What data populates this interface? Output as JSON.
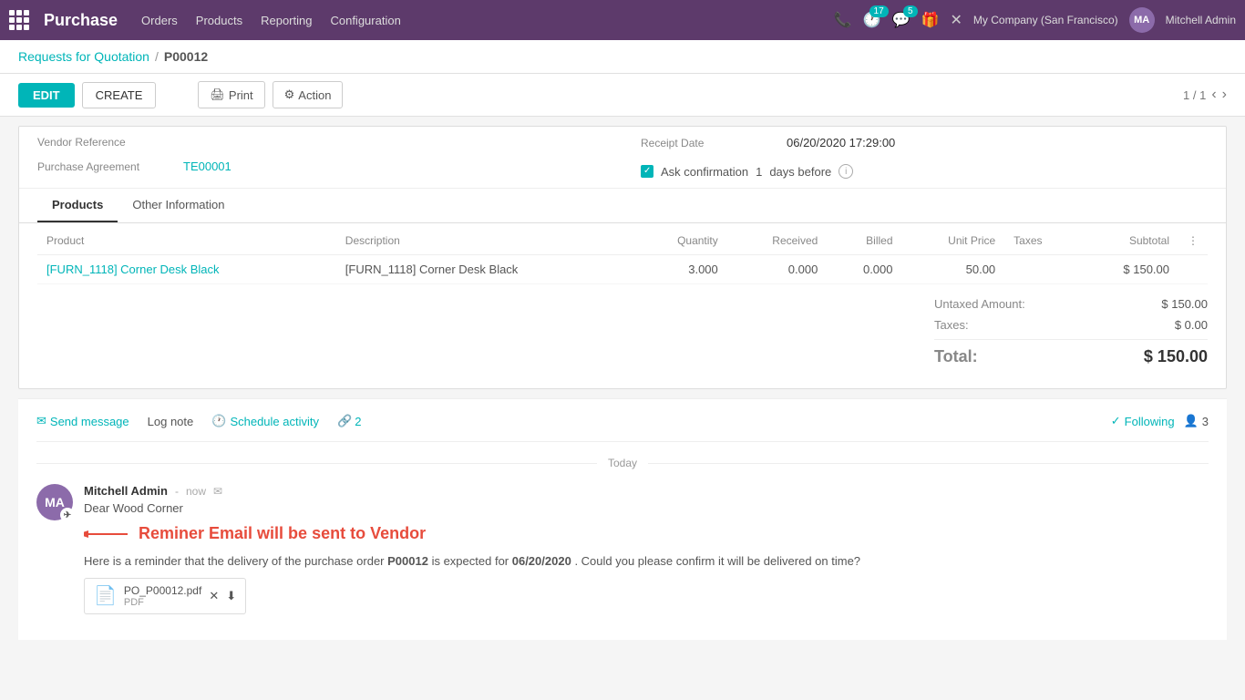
{
  "topnav": {
    "app_icon": "grid",
    "brand": "Purchase",
    "menu_items": [
      "Orders",
      "Products",
      "Reporting",
      "Configuration"
    ],
    "phone_icon": "phone",
    "activity_count": "17",
    "message_count": "5",
    "gift_icon": "gift",
    "close_icon": "x",
    "company": "My Company (San Francisco)",
    "username": "Mitchell Admin"
  },
  "breadcrumb": {
    "parent": "Requests for Quotation",
    "separator": "/",
    "current": "P00012"
  },
  "toolbar": {
    "edit_label": "EDIT",
    "create_label": "CREATE",
    "print_label": "Print",
    "action_label": "Action",
    "pagination": "1 / 1"
  },
  "form": {
    "vendor_reference_label": "Vendor Reference",
    "purchase_agreement_label": "Purchase Agreement",
    "purchase_agreement_value": "TE00001",
    "receipt_date_label": "Receipt Date",
    "receipt_date_value": "06/20/2020 17:29:00",
    "ask_confirmation_label": "Ask confirmation",
    "ask_confirmation_days": "1",
    "ask_confirmation_suffix": "days before"
  },
  "tabs": [
    {
      "id": "products",
      "label": "Products",
      "active": true
    },
    {
      "id": "other_information",
      "label": "Other Information",
      "active": false
    }
  ],
  "table": {
    "columns": [
      "Product",
      "Description",
      "Quantity",
      "Received",
      "Billed",
      "Unit Price",
      "Taxes",
      "Subtotal"
    ],
    "rows": [
      {
        "product": "[FURN_1118] Corner Desk Black",
        "description": "[FURN_1118] Corner Desk Black",
        "quantity": "3.000",
        "received": "0.000",
        "billed": "0.000",
        "unit_price": "50.00",
        "taxes": "",
        "subtotal": "$ 150.00"
      }
    ]
  },
  "totals": {
    "untaxed_amount_label": "Untaxed Amount:",
    "untaxed_amount_value": "$ 150.00",
    "taxes_label": "Taxes:",
    "taxes_value": "$ 0.00",
    "total_label": "Total:",
    "total_value": "$ 150.00"
  },
  "chatter": {
    "send_message_label": "Send message",
    "log_note_label": "Log note",
    "schedule_activity_label": "Schedule activity",
    "link_count": "2",
    "following_label": "Following",
    "followers_count": "3"
  },
  "messages": {
    "date_divider": "Today",
    "author": "Mitchell Admin",
    "time": "now",
    "greeting": "Dear Wood Corner",
    "body_start": "Here is a reminder that the delivery of the purchase order ",
    "order_number": "P00012",
    "body_mid": " is expected for ",
    "expected_date": "06/20/2020",
    "body_end": ". Could you please confirm it will be delivered on time?",
    "attachment_name": "PO_P00012.pdf",
    "attachment_type": "PDF"
  },
  "annotation": {
    "text": "Reminer Email will be sent to Vendor"
  }
}
